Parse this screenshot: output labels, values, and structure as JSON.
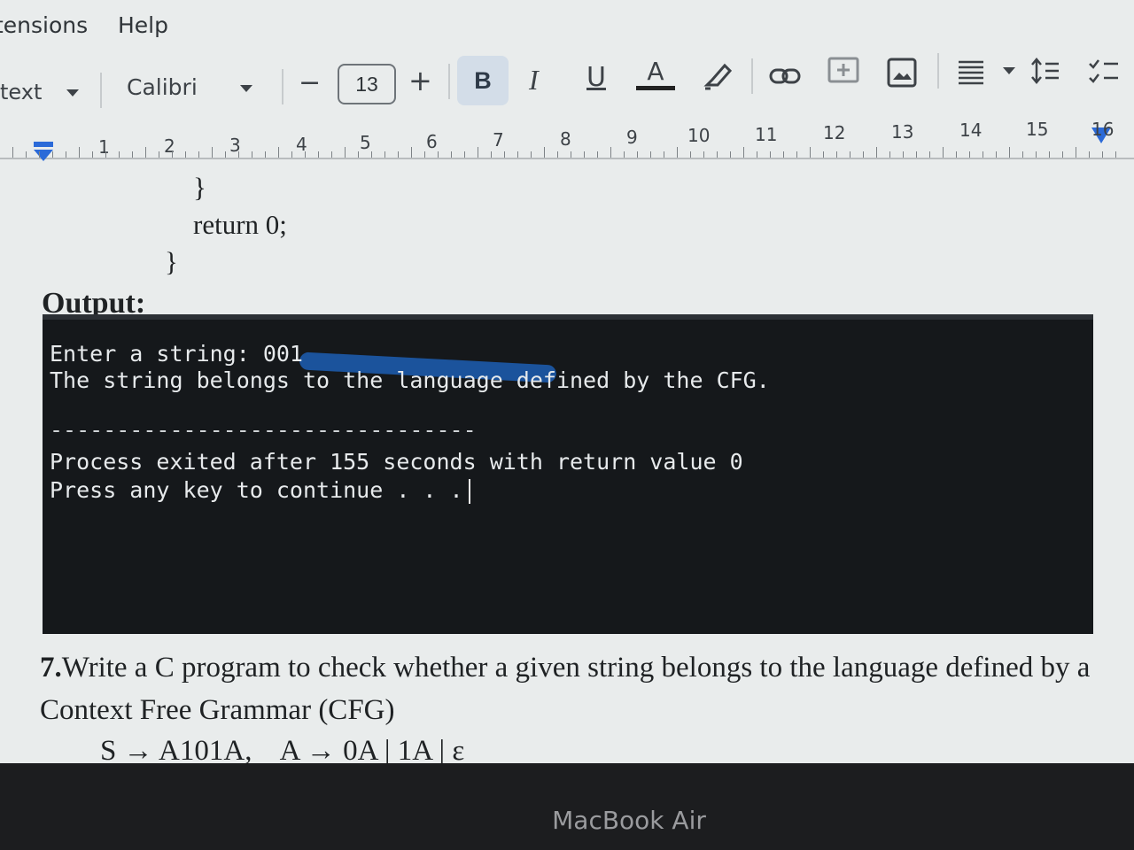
{
  "menubar": {
    "items": [
      "tensions",
      "Help"
    ]
  },
  "toolbar": {
    "style_value": "text",
    "font_value": "Calibri",
    "decrease_label": "−",
    "font_size": "13",
    "increase_label": "+",
    "bold_label": "B",
    "italic_label": "I",
    "underline_label": "U",
    "text_color_label": "A",
    "icons": [
      "highlighter-icon",
      "link-icon",
      "add-comment-icon",
      "image-icon",
      "align-icon",
      "line-spacing-icon",
      "checklist-icon"
    ]
  },
  "ruler": {
    "numbers": [
      "1",
      "2",
      "3",
      "4",
      "5",
      "6",
      "7",
      "8",
      "9",
      "10",
      "11",
      "12",
      "13",
      "14",
      "15",
      "16"
    ]
  },
  "document": {
    "code": [
      "}",
      "return 0;",
      "}"
    ],
    "heading": "Output:",
    "console": {
      "line1": "Enter a string: 001",
      "line2": "The string belongs to the language defined by the CFG.",
      "separator": "--------------------------------",
      "line3": "Process exited after 155 seconds with return value 0",
      "line4": "Press any key to continue . . ."
    },
    "question_number": "7.",
    "question_text": "Write a C program to check whether a given string belongs to the language defined by a Context Free Grammar (CFG)",
    "grammar": "S → A101A,    A → 0A | 1A | ε"
  },
  "bezel": {
    "brand": "MacBook Air"
  },
  "colors": {
    "console_bg": "#15181b",
    "selection": "#1d67c8",
    "bold_active": "#d3dde8"
  }
}
